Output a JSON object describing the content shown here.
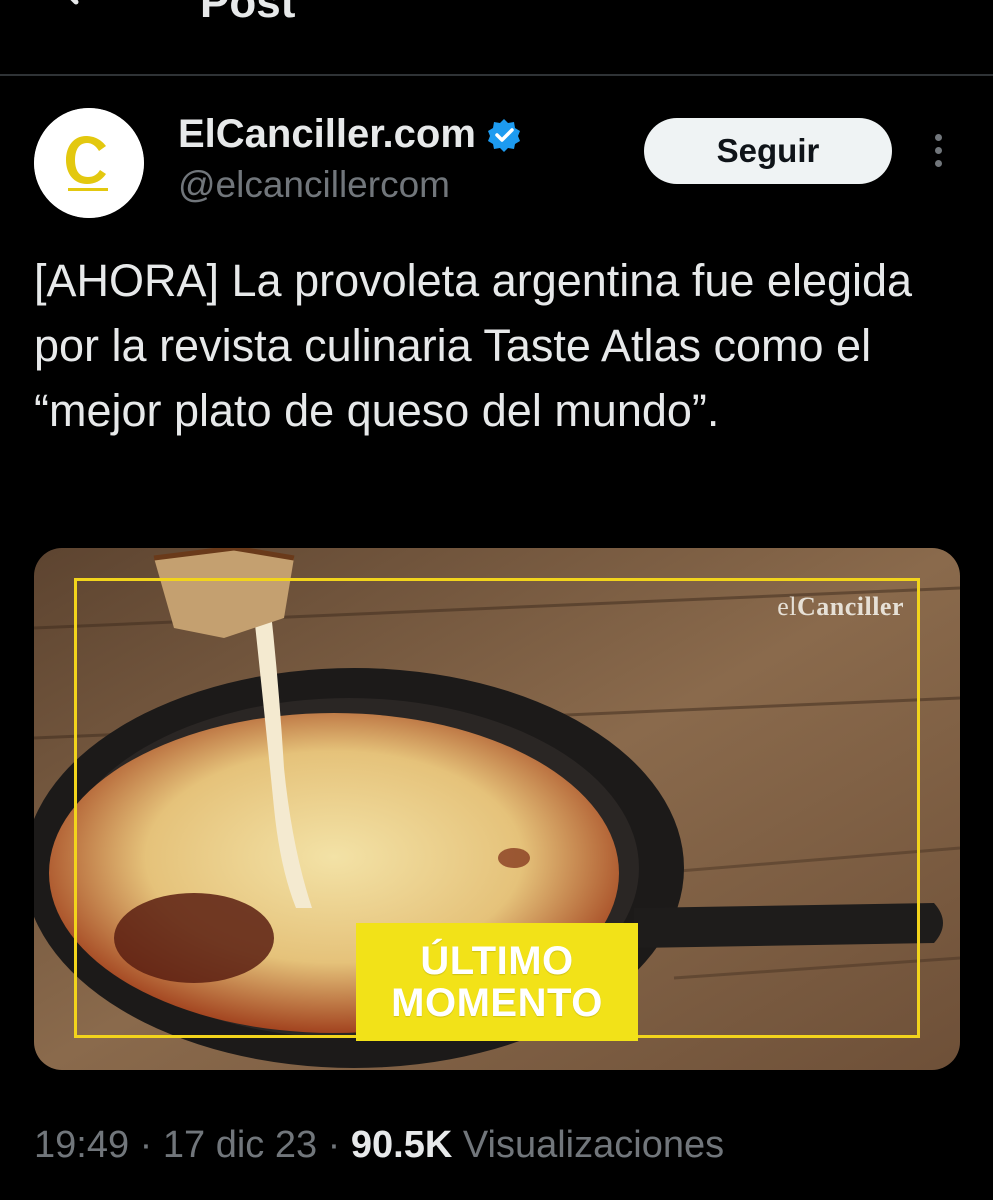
{
  "header": {
    "title": "Post"
  },
  "author": {
    "display_name": "ElCanciller.com",
    "handle": "@elcancillercom",
    "avatar_letter": "C",
    "verified": true
  },
  "actions": {
    "follow_label": "Seguir"
  },
  "tweet": {
    "text": "[AHORA] La provoleta argentina fue elegida por la revista culinaria Taste Atlas como el “mejor plato de queso del mundo”."
  },
  "media": {
    "watermark_prefix": "el",
    "watermark_brand": "Canciller",
    "badge_line1": "ÚLTIMO",
    "badge_line2": "MOMENTO"
  },
  "meta": {
    "time": "19:49",
    "date": "17 dic 23",
    "separator": " · ",
    "views_count": "90.5K",
    "views_label": "Visualizaciones"
  },
  "colors": {
    "background": "#000000",
    "text_primary": "#e7e9ea",
    "text_secondary": "#71767b",
    "verified": "#1d9bf0",
    "brand_yellow": "#f2e218"
  }
}
